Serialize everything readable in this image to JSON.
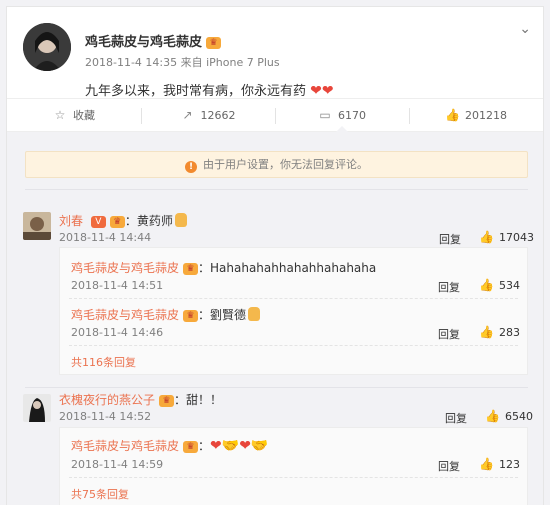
{
  "post": {
    "author": "鸡毛蒜皮与鸡毛蒜皮",
    "meta": "2018-11-4 14:35 来自 iPhone 7 Plus",
    "text": "九年多以来，我时常有病，你永远有药",
    "hearts": "❤❤"
  },
  "actions": [
    {
      "icon": "star-icon",
      "label": "收藏"
    },
    {
      "icon": "forward-icon",
      "label": "12662"
    },
    {
      "icon": "comment-icon",
      "label": "6170"
    },
    {
      "icon": "like-icon",
      "label": "201218"
    }
  ],
  "notice": "由于用户设置，你无法回复评论。",
  "reply_label": "回复",
  "comments": [
    {
      "user": "刘春",
      "badge": "V",
      "text": "：黄药师",
      "time": "2018-11-4 14:44",
      "likes": "17043",
      "replies": [
        {
          "user": "鸡毛蒜皮与鸡毛蒜皮",
          "text": "：Hahahahahhahahhahahaha",
          "time": "2018-11-4 14:51",
          "likes": "534"
        },
        {
          "user": "鸡毛蒜皮与鸡毛蒜皮",
          "text": "：劉賢德",
          "time": "2018-11-4 14:46",
          "likes": "283"
        }
      ],
      "more": "共116条回复"
    },
    {
      "user": "衣槐夜行的燕公子",
      "text": "：甜！！",
      "time": "2018-11-4 14:52",
      "likes": "6540",
      "replies": [
        {
          "user": "鸡毛蒜皮与鸡毛蒜皮",
          "text": "：",
          "emojis": "❤🤝❤🤝",
          "time": "2018-11-4 14:59",
          "likes": "123"
        }
      ],
      "more": "共75条回复"
    }
  ]
}
